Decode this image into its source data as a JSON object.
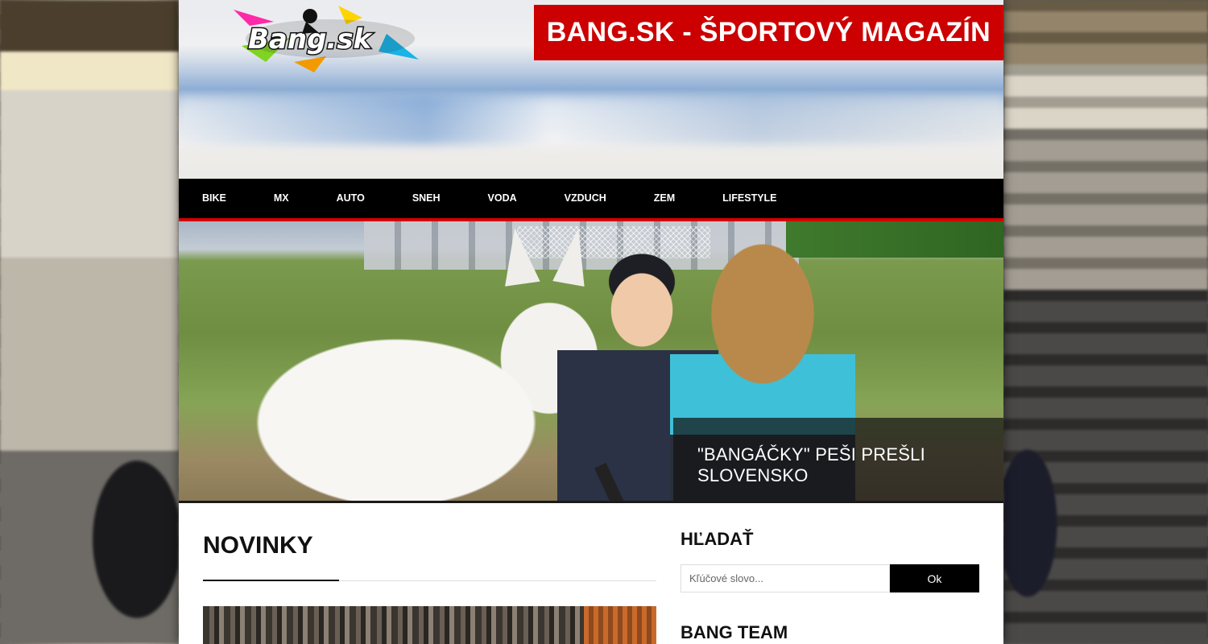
{
  "site": {
    "title": "BANG.SK - ŠPORTOVÝ MAGAZÍN",
    "logo_text": "Bang.sk"
  },
  "nav": {
    "items": [
      {
        "label": "BIKE"
      },
      {
        "label": "MX"
      },
      {
        "label": "AUTO"
      },
      {
        "label": "SNEH"
      },
      {
        "label": "VODA"
      },
      {
        "label": "VZDUCH"
      },
      {
        "label": "ZEM"
      },
      {
        "label": "LIFESTYLE"
      }
    ]
  },
  "hero": {
    "caption": "\"BANGÁČKY\" PEŠI PREŠLI SLOVENSKO"
  },
  "main": {
    "section_title": "NOVINKY"
  },
  "sidebar": {
    "search_title": "HĽADAŤ",
    "search_placeholder": "Kľúčové slovo...",
    "search_button": "Ok",
    "team_title": "BANG TEAM"
  },
  "colors": {
    "accent": "#cc0000",
    "nav_bg": "#000000",
    "nav_border": "#d40000"
  }
}
